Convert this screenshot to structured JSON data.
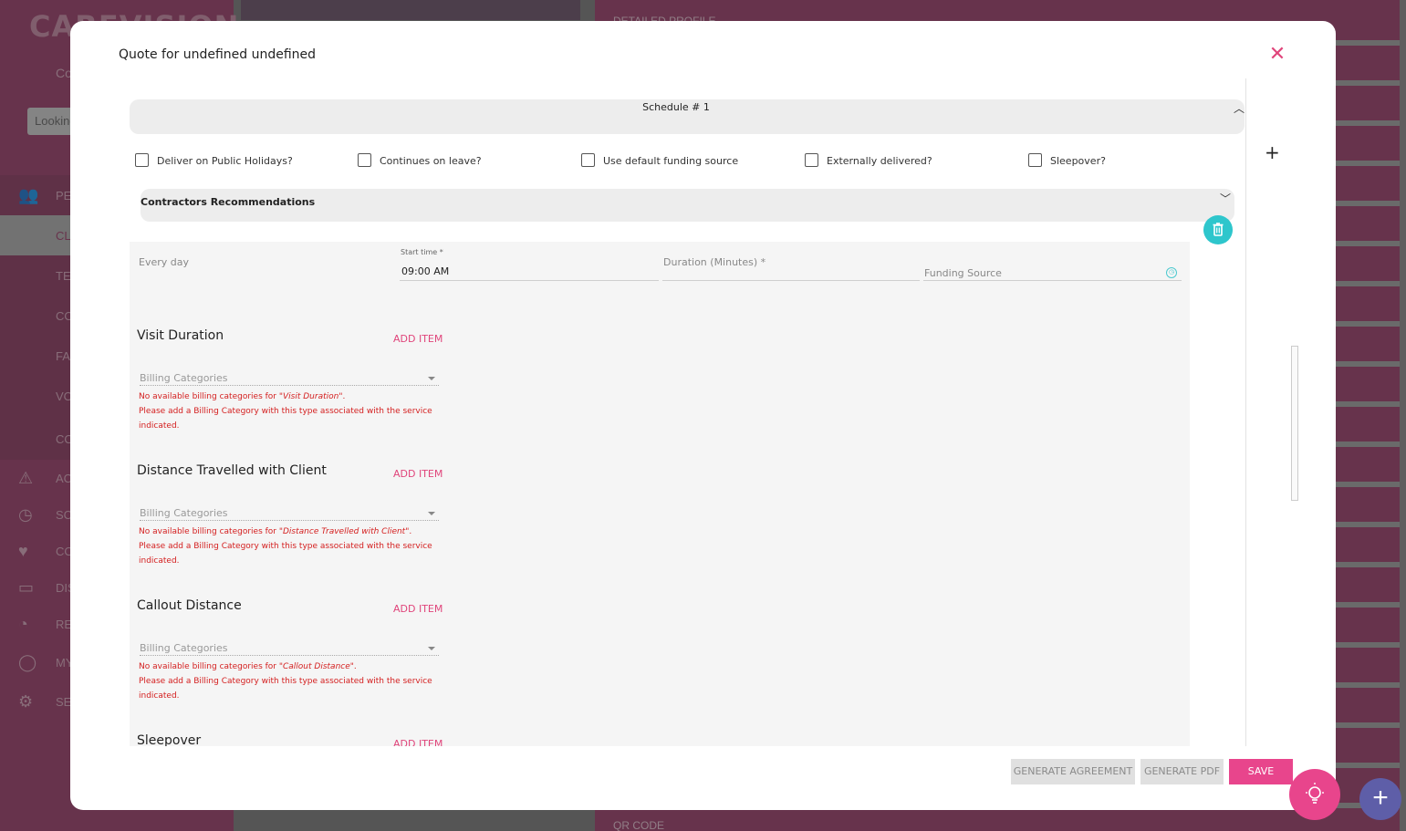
{
  "background": {
    "logo": "CAREVISION",
    "co_text": "Co",
    "search_placeholder": "Looking",
    "menu": [
      {
        "icon": "people-icon",
        "label": "PE"
      },
      {
        "icon": "",
        "label": "CL"
      },
      {
        "icon": "",
        "label": "TE"
      },
      {
        "icon": "",
        "label": "CO"
      },
      {
        "icon": "",
        "label": "FA"
      },
      {
        "icon": "",
        "label": "VO"
      },
      {
        "icon": "",
        "label": "CO"
      },
      {
        "icon": "warning-icon",
        "label": "AC"
      },
      {
        "icon": "clock-icon",
        "label": "SC"
      },
      {
        "icon": "hearts-icon",
        "label": "CO"
      },
      {
        "icon": "chat-icon",
        "label": "DIS"
      },
      {
        "icon": "gauge-icon",
        "label": "RE"
      },
      {
        "icon": "user-icon",
        "label": "MY"
      },
      {
        "icon": "gear-icon",
        "label": "SE"
      }
    ],
    "right_top_label": "DETAILED PROFILE",
    "right_bottom_label": "QR CODE"
  },
  "modal": {
    "title": "Quote for undefined undefined",
    "schedule_title": "Schedule # 1",
    "checkboxes": [
      "Deliver on Public Holidays?",
      "Continues on leave?",
      "Use default funding source",
      "Externally delivered?",
      "Sleepover?"
    ],
    "contractors_title": "Contractors Recommendations",
    "every_day": "Every day",
    "start_time_label": "Start time *",
    "start_time_value": "09:00 AM",
    "duration_label": "Duration (Minutes) *",
    "funding_source_placeholder": "Funding Source",
    "sections": [
      {
        "title": "Visit Duration",
        "add_item": "ADD ITEM",
        "billing_placeholder": "Billing Categories",
        "error_prefix": "No available billing categories for ",
        "error_name": "\"Visit Duration\"",
        "error_suffix": ".",
        "error_line2": "Please add a Billing Category with this type associated with the service indicated."
      },
      {
        "title": "Distance Travelled with Client",
        "add_item": "ADD ITEM",
        "billing_placeholder": "Billing Categories",
        "error_prefix": "No available billing categories for ",
        "error_name": "\"Distance Travelled with Client\"",
        "error_suffix": ".",
        "error_line2": "Please add a Billing Category with this type associated with the service indicated."
      },
      {
        "title": "Callout Distance",
        "add_item": "ADD ITEM",
        "billing_placeholder": "Billing Categories",
        "error_prefix": "No available billing categories for ",
        "error_name": "\"Callout Distance\"",
        "error_suffix": ".",
        "error_line2": "Please add a Billing Category with this type associated with the service indicated."
      },
      {
        "title": "Sleepover",
        "add_item": "ADD ITEM"
      }
    ],
    "buttons": {
      "generate_agreement": "GENERATE AGREEMENT",
      "generate_pdf": "GENERATE PDF",
      "save": "SAVE"
    }
  },
  "colors": {
    "accent": "#e8458c",
    "sidebar": "#9c3d6a",
    "teal": "#2ec6cc",
    "error": "#d42020"
  }
}
